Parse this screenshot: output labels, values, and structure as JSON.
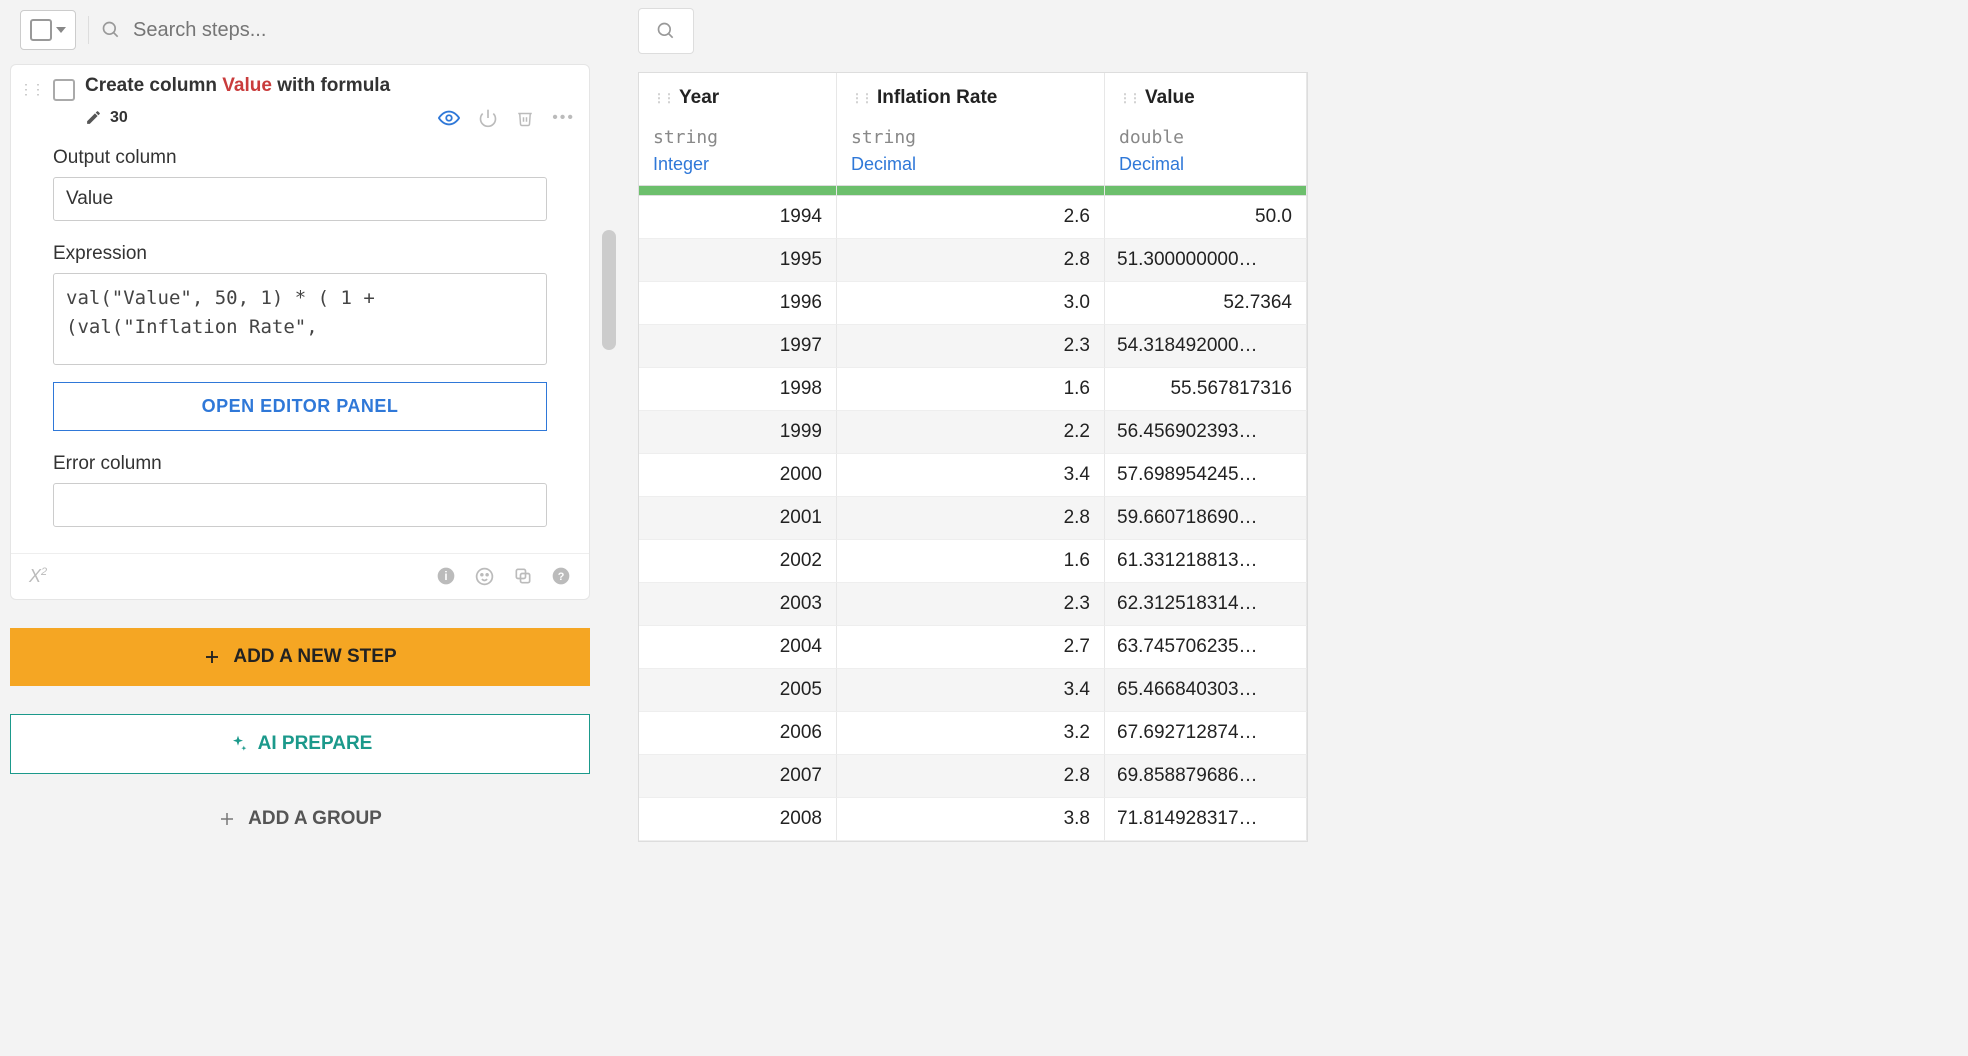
{
  "search": {
    "placeholder": "Search steps..."
  },
  "step": {
    "title_prefix": "Create column ",
    "title_colname": "Value",
    "title_suffix": " with formula",
    "count": "30",
    "output_label": "Output column",
    "output_value": "Value",
    "expression_label": "Expression",
    "expression_value": "val(\"Value\", 50, 1) * ( 1 + (val(\"Inflation Rate\",",
    "open_editor": "OPEN EDITOR PANEL",
    "error_label": "Error column",
    "error_value": ""
  },
  "buttons": {
    "add_step": "ADD A NEW STEP",
    "ai_prepare": "AI PREPARE",
    "add_group": "ADD A GROUP"
  },
  "table": {
    "columns": [
      {
        "name": "Year",
        "type": "string",
        "meaning": "Integer"
      },
      {
        "name": "Inflation Rate",
        "type": "string",
        "meaning": "Decimal"
      },
      {
        "name": "Value",
        "type": "double",
        "meaning": "Decimal"
      }
    ],
    "rows": [
      {
        "year": "1994",
        "rate": "2.6",
        "value": "50.0",
        "first": true
      },
      {
        "year": "1995",
        "rate": "2.8",
        "value": "51.300000000…"
      },
      {
        "year": "1996",
        "rate": "3.0",
        "value": "52.7364"
      },
      {
        "year": "1997",
        "rate": "2.3",
        "value": "54.318492000…"
      },
      {
        "year": "1998",
        "rate": "1.6",
        "value": "55.567817316"
      },
      {
        "year": "1999",
        "rate": "2.2",
        "value": "56.456902393…"
      },
      {
        "year": "2000",
        "rate": "3.4",
        "value": "57.698954245…"
      },
      {
        "year": "2001",
        "rate": "2.8",
        "value": "59.660718690…"
      },
      {
        "year": "2002",
        "rate": "1.6",
        "value": "61.331218813…"
      },
      {
        "year": "2003",
        "rate": "2.3",
        "value": "62.312518314…"
      },
      {
        "year": "2004",
        "rate": "2.7",
        "value": "63.745706235…"
      },
      {
        "year": "2005",
        "rate": "3.4",
        "value": "65.466840303…"
      },
      {
        "year": "2006",
        "rate": "3.2",
        "value": "67.692712874…"
      },
      {
        "year": "2007",
        "rate": "2.8",
        "value": "69.858879686…"
      },
      {
        "year": "2008",
        "rate": "3.8",
        "value": "71.814928317…"
      }
    ]
  }
}
